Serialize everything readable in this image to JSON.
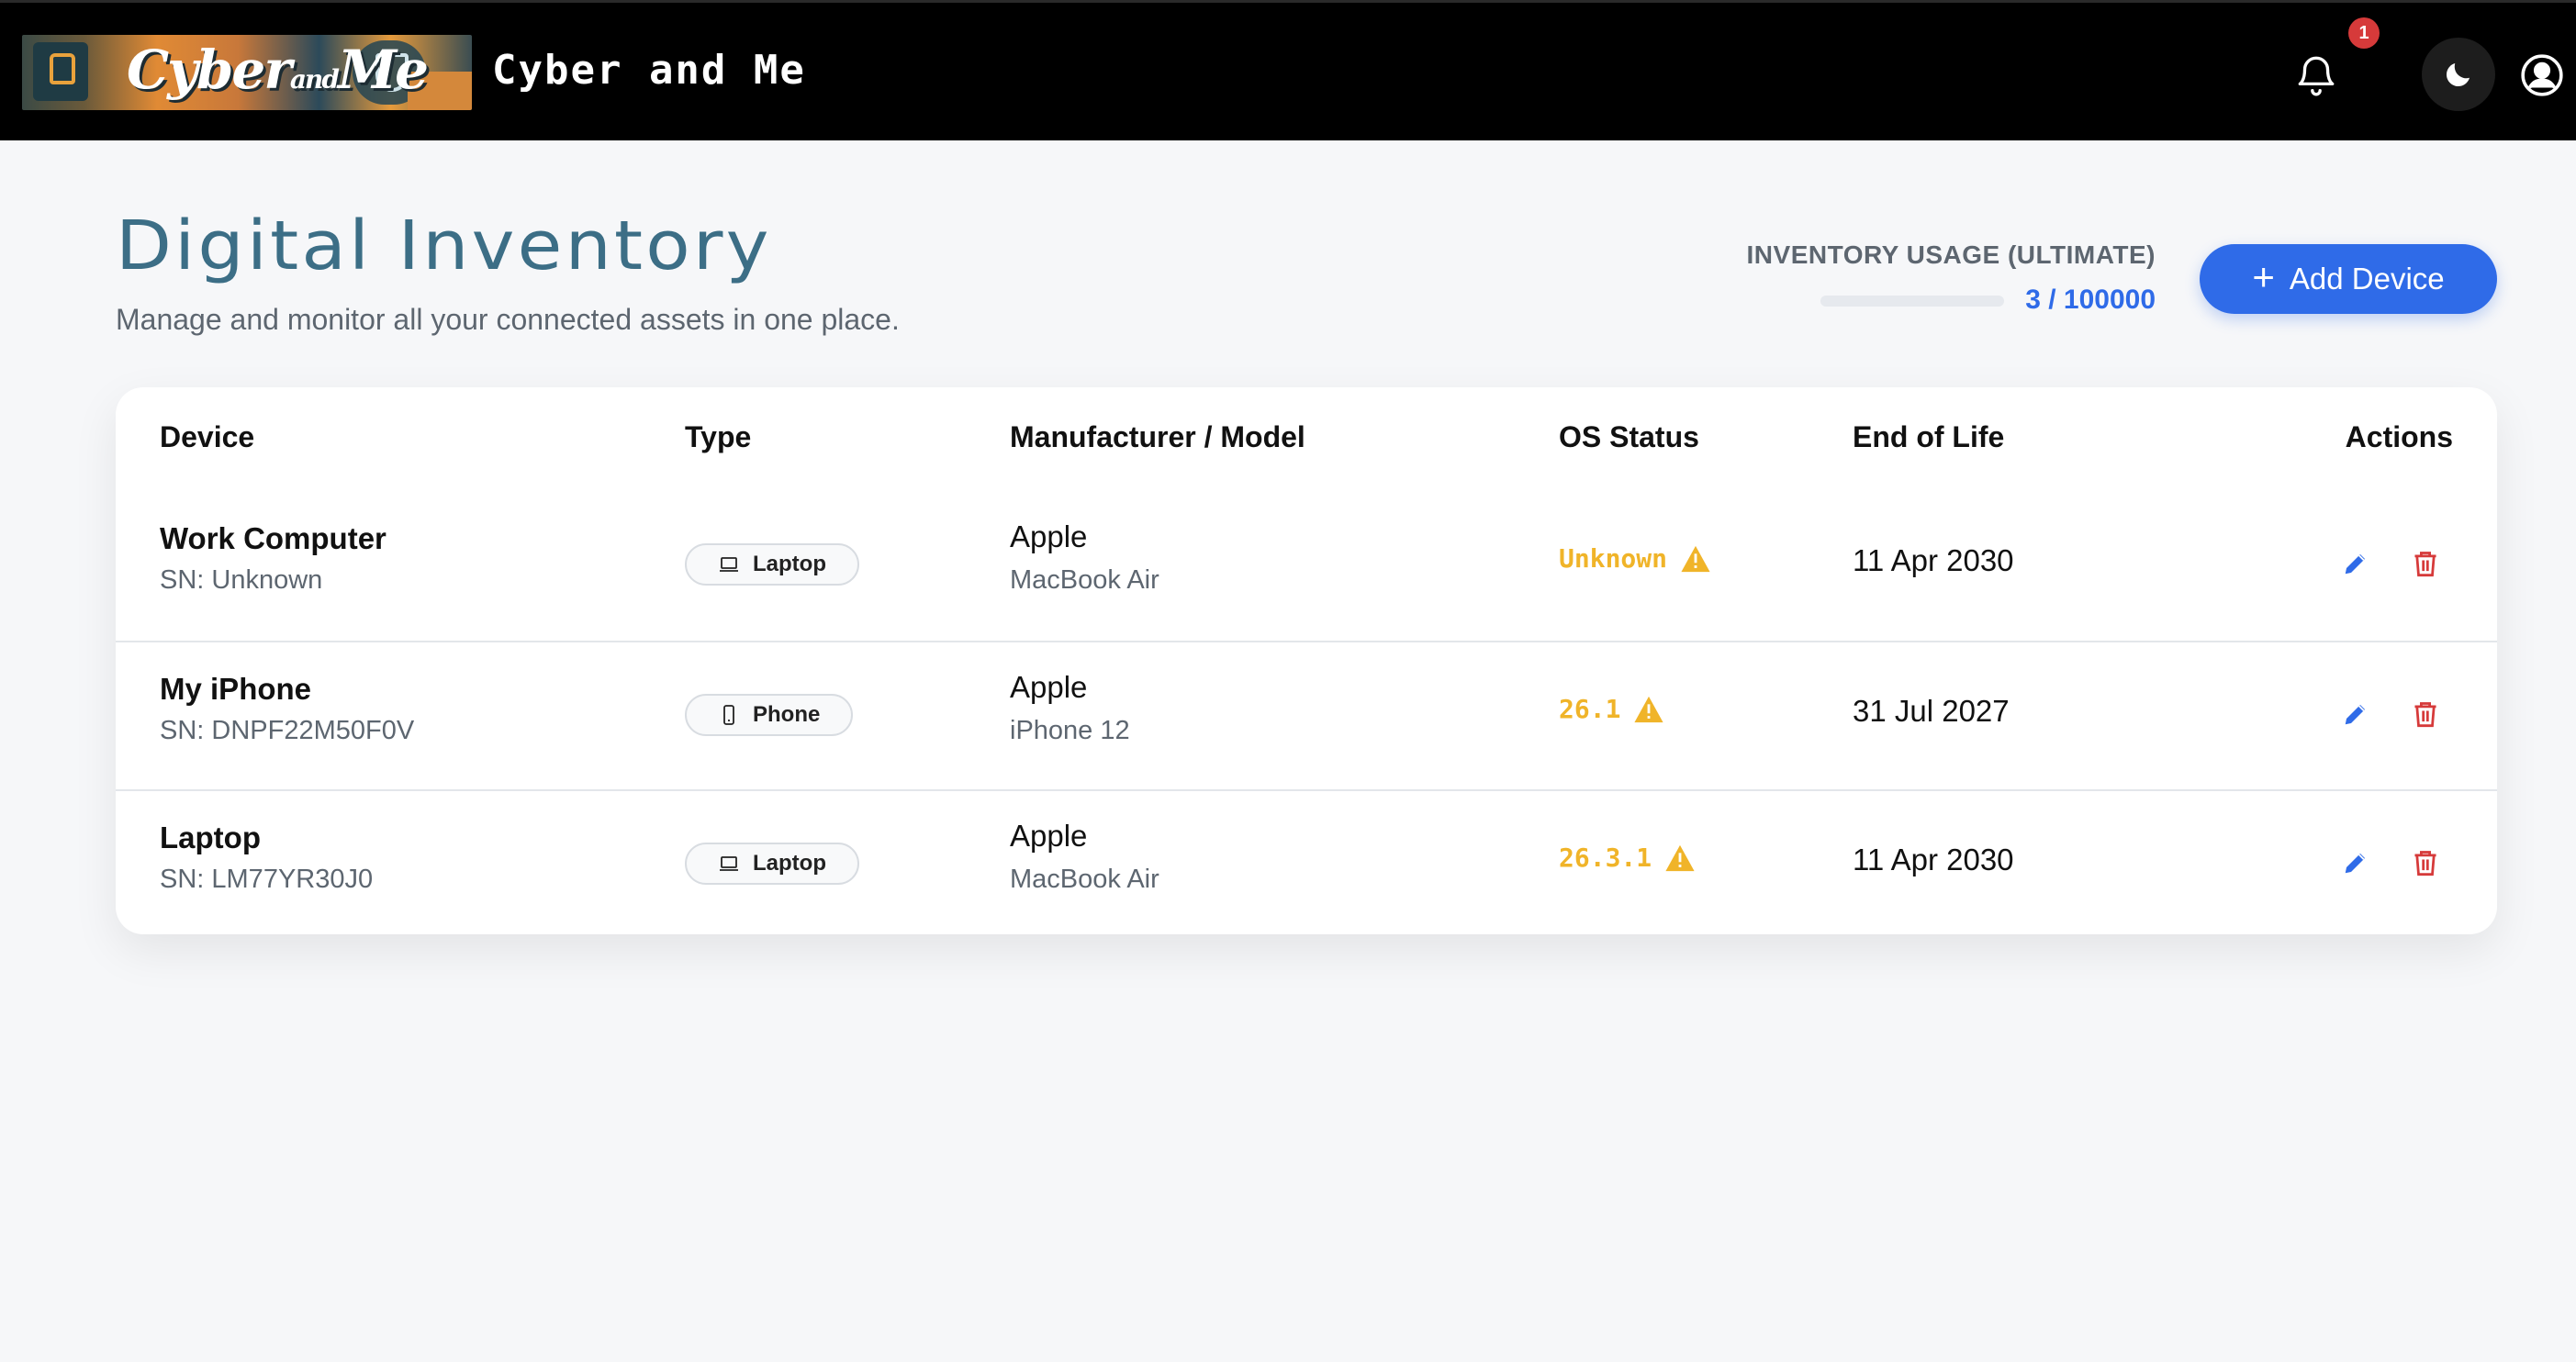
{
  "header": {
    "logo_text_main": "Cyber",
    "logo_text_and": "and",
    "logo_text_me": "Me",
    "brand": "Cyber and Me",
    "notification_count": "1",
    "icons": {
      "bell": "bell-icon",
      "theme": "moon-icon",
      "user": "user-circle-icon"
    }
  },
  "page": {
    "title": "Digital Inventory",
    "subtitle": "Manage and monitor all your connected assets in one place.",
    "usage_label": "INVENTORY USAGE (ULTIMATE)",
    "usage_count": "3 / 100000",
    "usage_fraction": 3e-05,
    "add_button": "Add Device"
  },
  "table": {
    "headers": {
      "device": "Device",
      "type": "Type",
      "manufacturer": "Manufacturer / Model",
      "os_status": "OS Status",
      "end_of_life": "End of Life",
      "actions": "Actions"
    },
    "rows": [
      {
        "name": "Work Computer",
        "serial": "SN: Unknown",
        "type": "Laptop",
        "type_icon": "laptop-icon",
        "manufacturer": "Apple",
        "model": "MacBook Air",
        "os": "Unknown",
        "eol": "11 Apr 2030"
      },
      {
        "name": "My iPhone",
        "serial": "SN: DNPF22M50F0V",
        "type": "Phone",
        "type_icon": "phone-icon",
        "manufacturer": "Apple",
        "model": "iPhone 12",
        "os": "26.1",
        "eol": "31 Jul 2027"
      },
      {
        "name": "Laptop",
        "serial": "SN: LM77YR30J0",
        "type": "Laptop",
        "type_icon": "laptop-icon",
        "manufacturer": "Apple",
        "model": "MacBook Air",
        "os": "26.3.1",
        "eol": "11 Apr 2030"
      }
    ]
  },
  "colors": {
    "accent": "#2f6be8",
    "title": "#3c6e86",
    "warning": "#f0b429",
    "danger": "#d63a3a",
    "header_bg": "#000000"
  }
}
